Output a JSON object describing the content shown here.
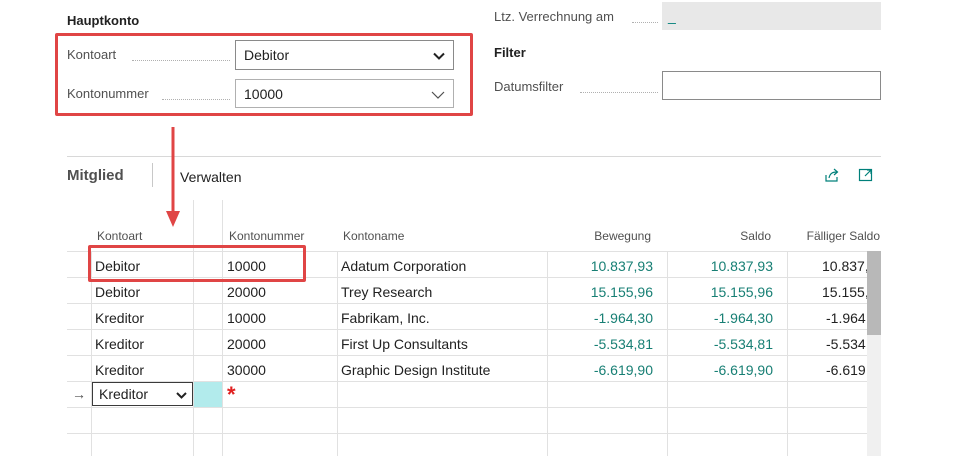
{
  "general": {
    "hauptkonto_title": "Hauptkonto",
    "kontoart_label": "Kontoart",
    "kontoart_value": "Debitor",
    "kontonummer_label": "Kontonummer",
    "kontonummer_value": "10000",
    "ltz_label": "Ltz. Verrechnung am",
    "ltz_value": "_",
    "filter_title": "Filter",
    "datumsfilter_label": "Datumsfilter",
    "datumsfilter_value": ""
  },
  "subpage": {
    "title": "Mitglied",
    "action_verwalten": "Verwalten",
    "icons": [
      "share-icon",
      "expand-icon"
    ]
  },
  "table": {
    "headers": {
      "kontoart": "Kontoart",
      "kontonummer": "Kontonummer",
      "kontoname": "Kontoname",
      "bewegung": "Bewegung",
      "saldo": "Saldo",
      "faelliger_saldo": "Fälliger Saldo"
    },
    "rows": [
      {
        "kontoart": "Debitor",
        "kontonummer": "10000",
        "kontoname": "Adatum Corporation",
        "bewegung": "10.837,93",
        "saldo": "10.837,93",
        "faellig": "10.837,"
      },
      {
        "kontoart": "Debitor",
        "kontonummer": "20000",
        "kontoname": "Trey Research",
        "bewegung": "15.155,96",
        "saldo": "15.155,96",
        "faellig": "15.155,"
      },
      {
        "kontoart": "Kreditor",
        "kontonummer": "10000",
        "kontoname": "Fabrikam, Inc.",
        "bewegung": "-1.964,30",
        "saldo": "-1.964,30",
        "faellig": "-1.964,"
      },
      {
        "kontoart": "Kreditor",
        "kontonummer": "20000",
        "kontoname": "First Up Consultants",
        "bewegung": "-5.534,81",
        "saldo": "-5.534,81",
        "faellig": "-5.534,"
      },
      {
        "kontoart": "Kreditor",
        "kontonummer": "30000",
        "kontoname": "Graphic Design Institute",
        "bewegung": "-6.619,90",
        "saldo": "-6.619,90",
        "faellig": "-6.619,"
      }
    ],
    "new_row": {
      "kontoart": "Kreditor",
      "indicator": "→",
      "required_marker": "*"
    }
  },
  "colors": {
    "highlight": "#e04545",
    "amount": "#177f74",
    "accent": "#00807a",
    "required": "#e02020",
    "new_row_cell": "#b2ebec"
  }
}
